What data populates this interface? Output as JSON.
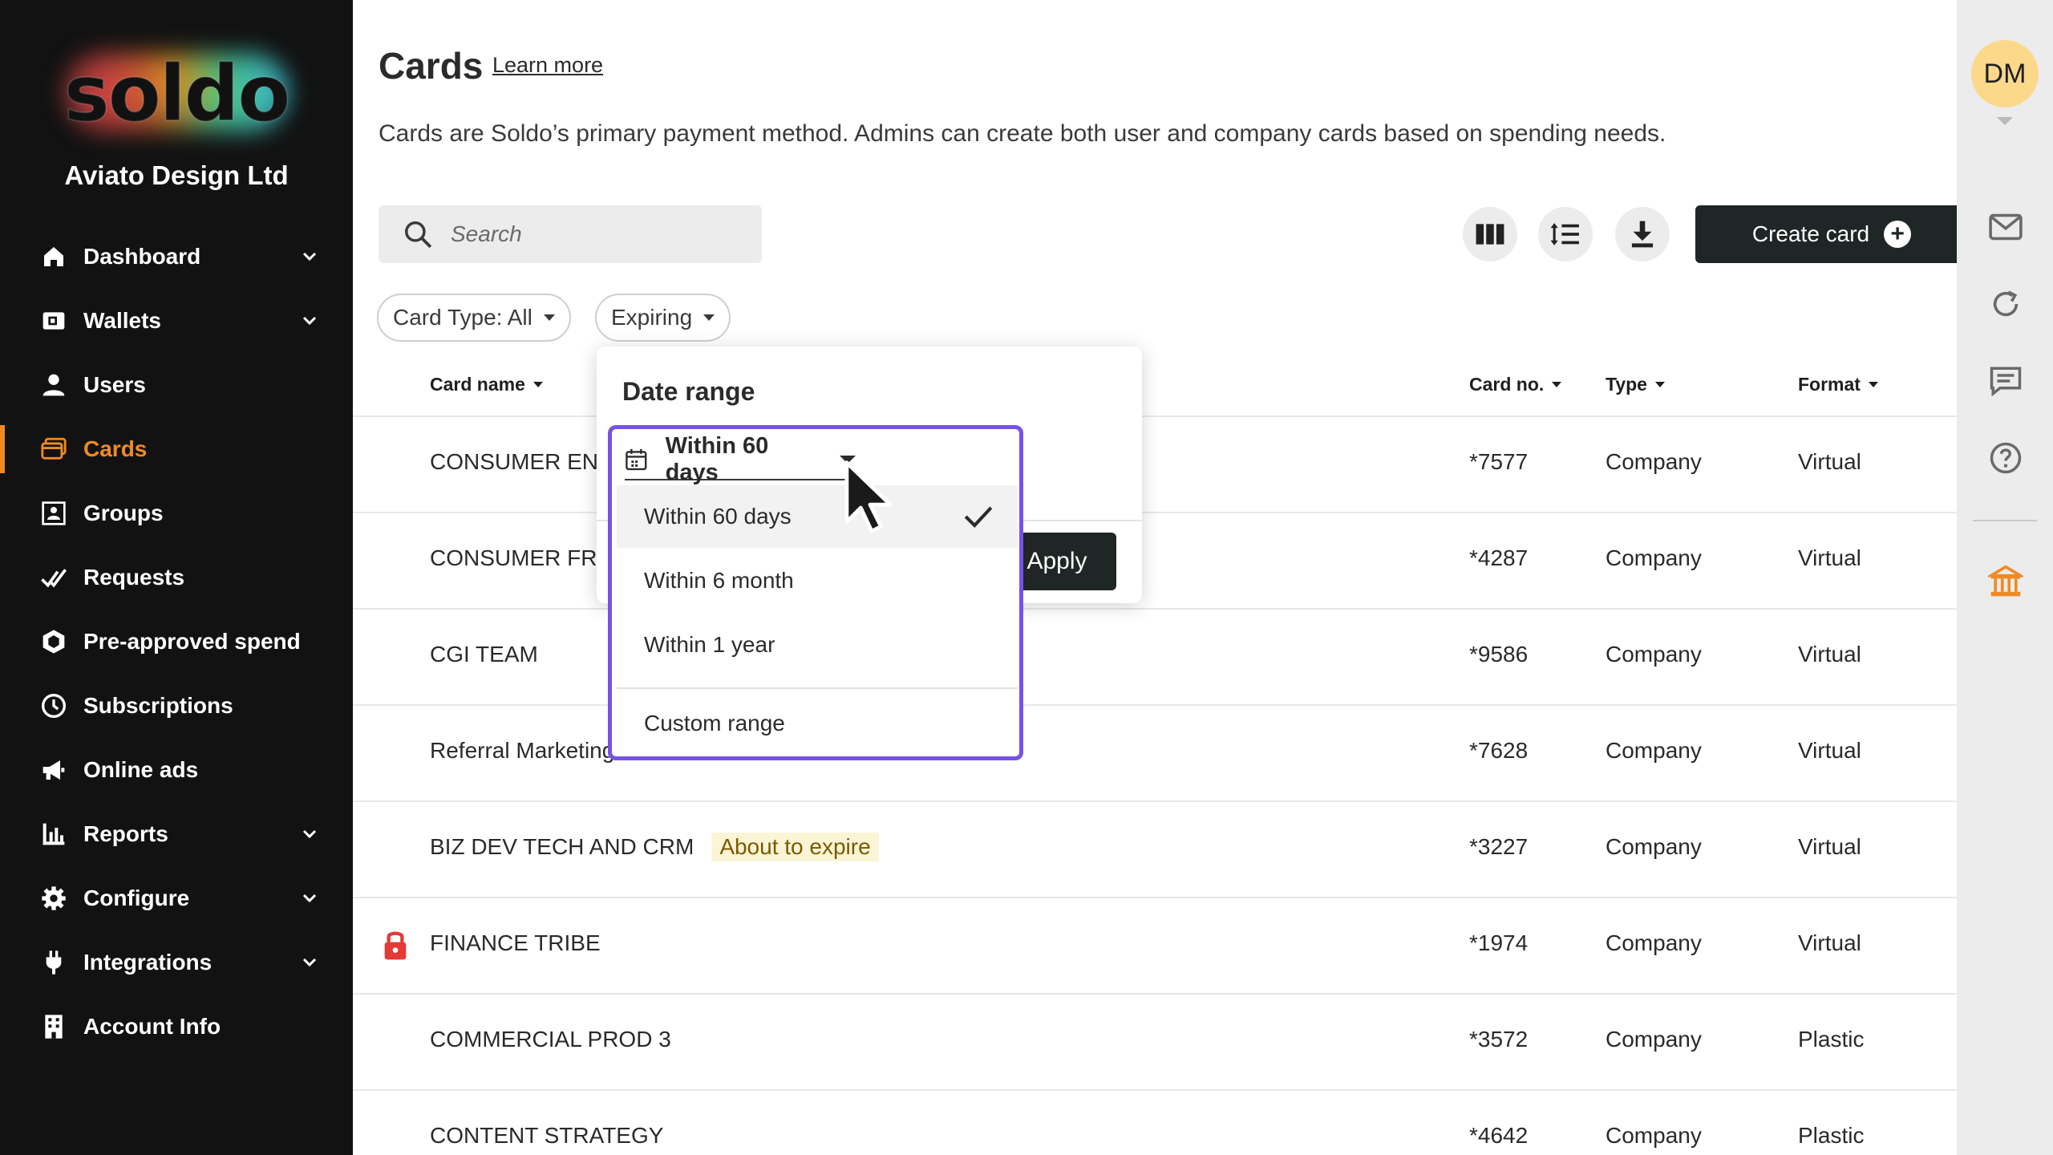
{
  "brand": {
    "logo_text": "soldo",
    "company": "Aviato Design Ltd"
  },
  "nav": {
    "items": [
      {
        "label": "Dashboard",
        "icon": "home-icon",
        "expandable": true
      },
      {
        "label": "Wallets",
        "icon": "wallet-icon",
        "expandable": true
      },
      {
        "label": "Users",
        "icon": "user-icon",
        "expandable": false
      },
      {
        "label": "Cards",
        "icon": "card-icon",
        "expandable": false,
        "active": true
      },
      {
        "label": "Groups",
        "icon": "groups-icon",
        "expandable": false
      },
      {
        "label": "Requests",
        "icon": "requests-icon",
        "expandable": false
      },
      {
        "label": "Pre-approved spend",
        "icon": "hexagon-icon",
        "expandable": false
      },
      {
        "label": "Subscriptions",
        "icon": "clock-icon",
        "expandable": false
      },
      {
        "label": "Online ads",
        "icon": "megaphone-icon",
        "expandable": false
      },
      {
        "label": "Reports",
        "icon": "bar-chart-icon",
        "expandable": true
      },
      {
        "label": "Configure",
        "icon": "gear-icon",
        "expandable": true
      },
      {
        "label": "Integrations",
        "icon": "plug-icon",
        "expandable": true
      },
      {
        "label": "Account Info",
        "icon": "building-icon",
        "expandable": false
      }
    ]
  },
  "header": {
    "title": "Cards",
    "learn_more": "Learn more",
    "description": "Cards are Soldo’s primary payment method. Admins can create both user and company cards based on spending needs."
  },
  "toolbar": {
    "search_placeholder": "Search",
    "create_label": "Create card"
  },
  "filters": {
    "card_type": "Card Type: All",
    "expiring": "Expiring"
  },
  "table": {
    "columns": {
      "name": "Card name",
      "number": "Card no.",
      "type": "Type",
      "format": "Format"
    },
    "rows": [
      {
        "name": "CONSUMER ENG",
        "number": "*7577",
        "type": "Company",
        "format": "Virtual"
      },
      {
        "name": "CONSUMER FRO",
        "number": "*4287",
        "type": "Company",
        "format": "Virtual"
      },
      {
        "name": "CGI TEAM",
        "number": "*9586",
        "type": "Company",
        "format": "Virtual"
      },
      {
        "name": "Referral Marketing",
        "number": "*7628",
        "type": "Company",
        "format": "Virtual"
      },
      {
        "name": "BIZ DEV TECH AND CRM",
        "badge": "About to expire",
        "number": "*3227",
        "type": "Company",
        "format": "Virtual"
      },
      {
        "name": "FINANCE TRIBE",
        "locked": true,
        "number": "*1974",
        "type": "Company",
        "format": "Virtual"
      },
      {
        "name": "COMMERCIAL PROD 3",
        "number": "*3572",
        "type": "Company",
        "format": "Plastic"
      },
      {
        "name": "CONTENT STRATEGY",
        "number": "*4642",
        "type": "Company",
        "format": "Plastic"
      }
    ]
  },
  "date_range": {
    "title": "Date range",
    "selected": "Within 60 days",
    "apply": "Apply",
    "options": [
      "Within 60 days",
      "Within 6 month",
      "Within 1 year",
      "Custom range"
    ]
  },
  "user": {
    "initials": "DM"
  },
  "colors": {
    "accent": "#f08a24",
    "highlight": "#7653e6",
    "dark": "#1f2626",
    "badge_bg": "#fbf5d6"
  }
}
